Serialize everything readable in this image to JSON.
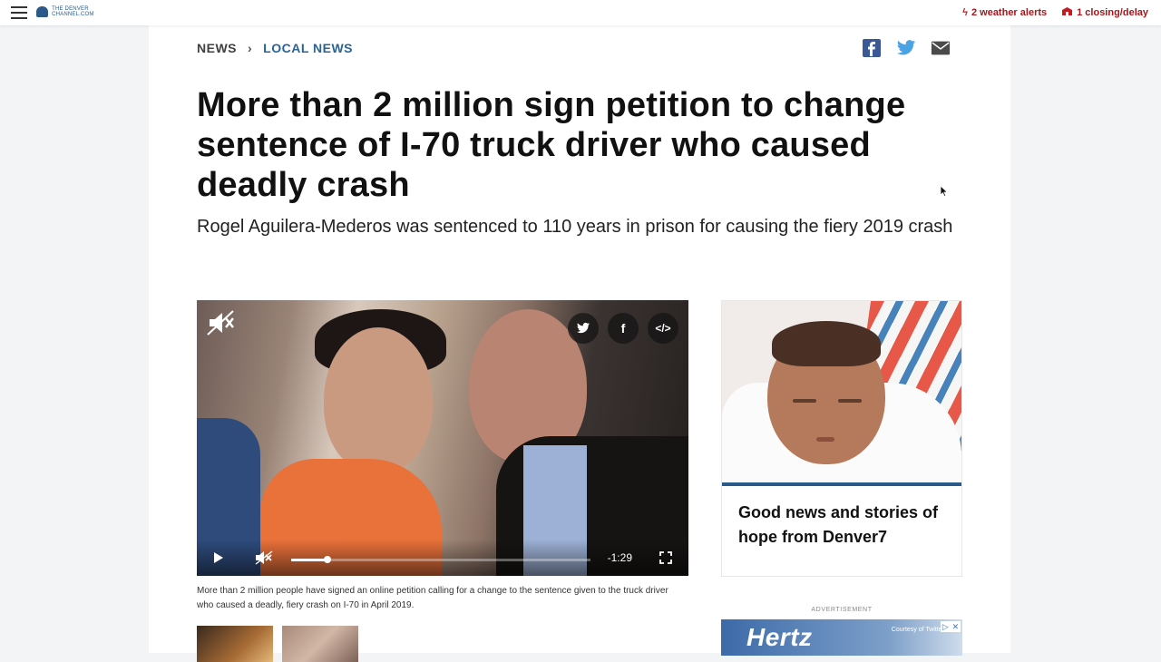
{
  "header": {
    "logo_text": "THE DENVER CHANNEL.COM",
    "weather_alerts": "2 weather alerts",
    "closings": "1 closing/delay"
  },
  "breadcrumb": {
    "section": "NEWS",
    "subsection": "LOCAL NEWS"
  },
  "article": {
    "headline": "More than 2 million sign petition to change sentence of I-70 truck driver who caused deadly crash",
    "dek": "Rogel Aguilera-Mederos was sentenced to 110 years in prison for causing the fiery 2019 crash",
    "caption": "More than 2 million people have signed an online petition calling for a change to the sentence given to the truck driver who caused a deadly, fiery crash on I-70 in April 2019."
  },
  "video": {
    "time_remaining": "-1:29",
    "progress": 0.12,
    "twitter_glyph": "t",
    "facebook_glyph": "f",
    "embed_glyph": "</>"
  },
  "promo": {
    "title": "Good news and stories of hope from Denver7"
  },
  "ad": {
    "label": "ADVERTISEMENT",
    "brand": "Hertz",
    "credit": "Courtesy of Twitter"
  },
  "colors": {
    "accent": "#2a6496",
    "alert": "#a8151a"
  }
}
